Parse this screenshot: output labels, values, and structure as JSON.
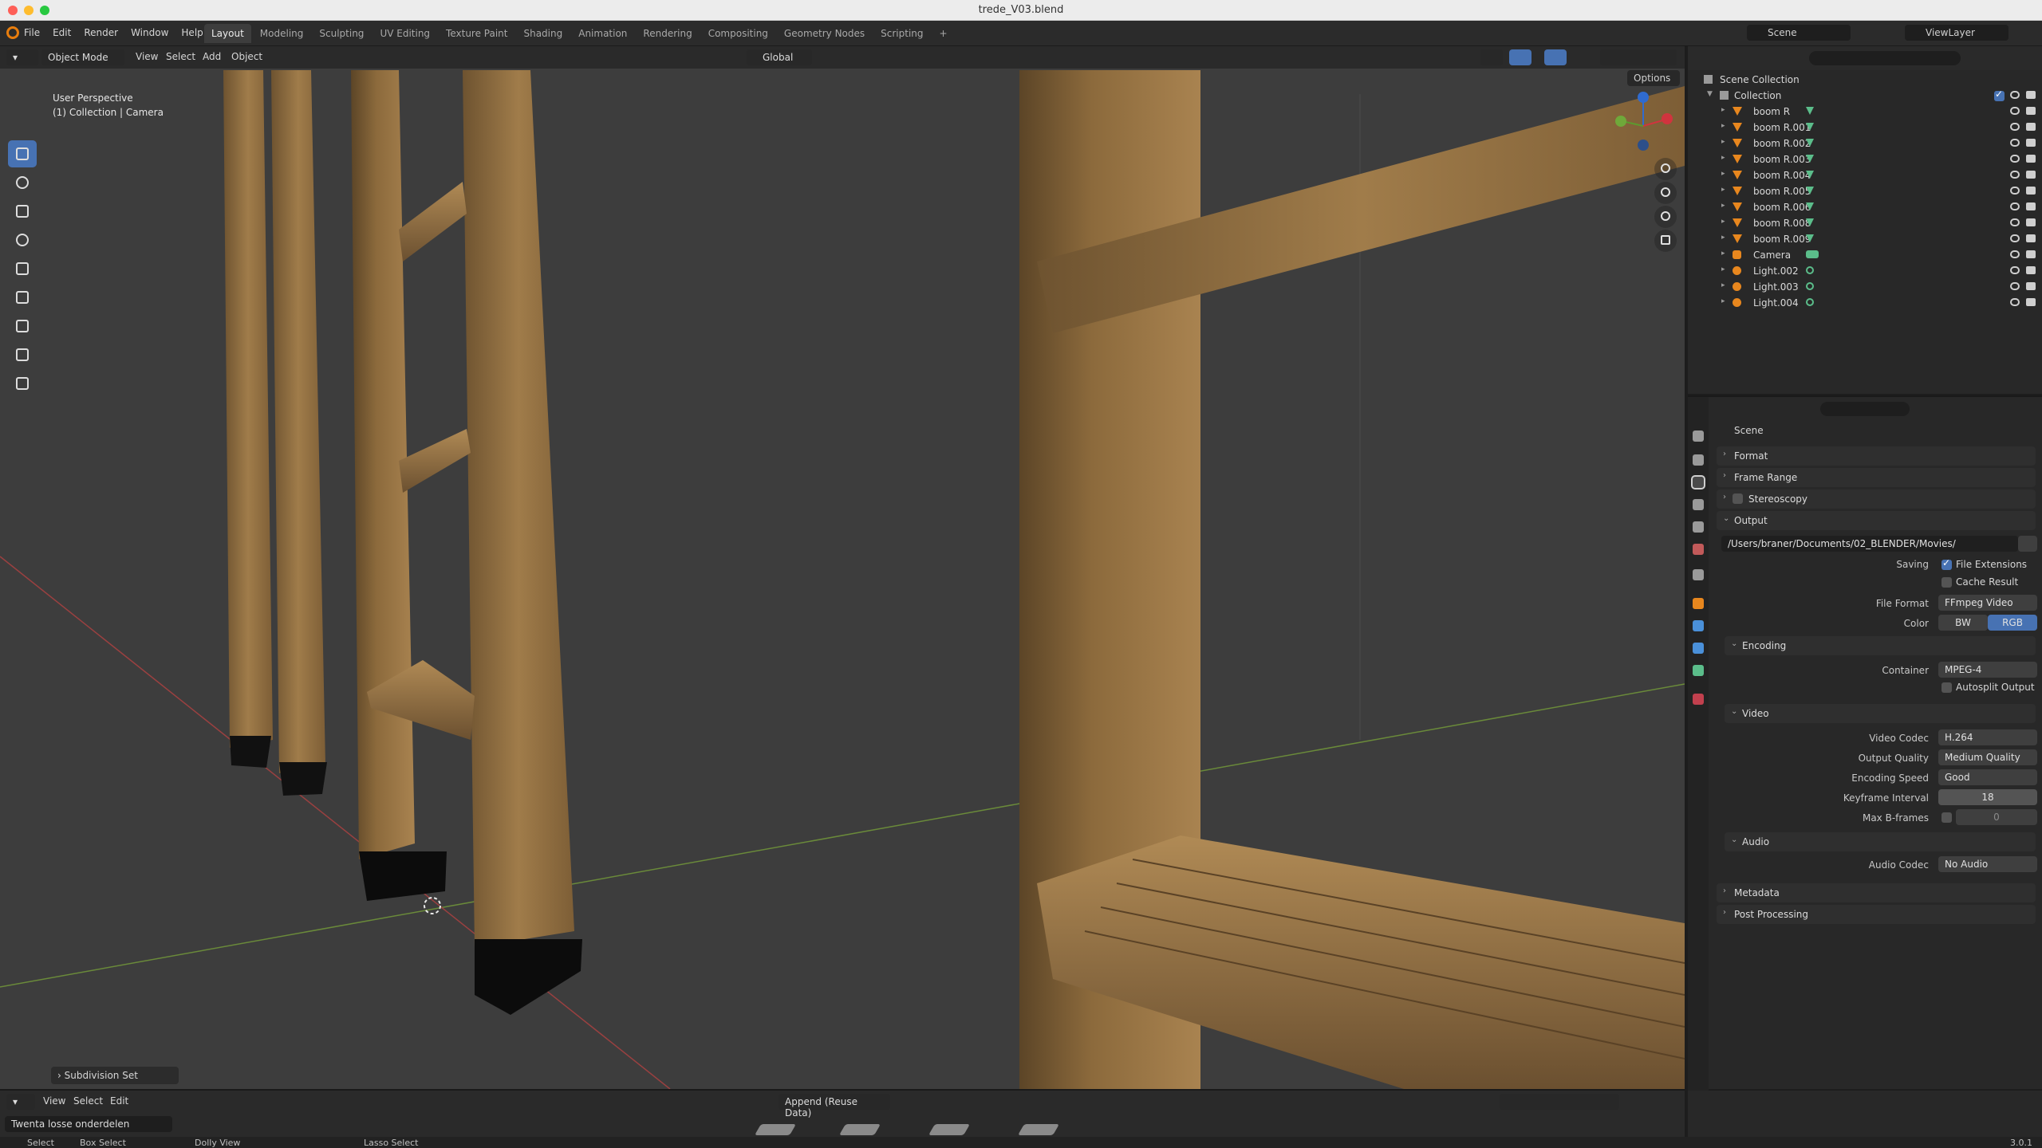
{
  "window": {
    "title": "trede_V03.blend"
  },
  "menu": [
    "File",
    "Edit",
    "Render",
    "Window",
    "Help"
  ],
  "workspaces": [
    "Layout",
    "Modeling",
    "Sculpting",
    "UV Editing",
    "Texture Paint",
    "Shading",
    "Animation",
    "Rendering",
    "Compositing",
    "Geometry Nodes",
    "Scripting",
    "+"
  ],
  "scene_name": "Scene",
  "view_layer": "ViewLayer",
  "viewport": {
    "mode": "Object Mode",
    "menus": [
      "View",
      "Select",
      "Add",
      "Object"
    ],
    "orientation": "Global",
    "info_line1": "User Perspective",
    "info_line2": "(1) Collection | Camera",
    "options_label": "Options",
    "last_op": "Subdivision Set"
  },
  "outliner": {
    "root": "Scene Collection",
    "collection": "Collection",
    "items": [
      {
        "name": "boom R",
        "type": "mesh"
      },
      {
        "name": "boom R.001",
        "type": "mesh"
      },
      {
        "name": "boom R.002",
        "type": "mesh"
      },
      {
        "name": "boom R.003",
        "type": "mesh"
      },
      {
        "name": "boom R.004",
        "type": "mesh"
      },
      {
        "name": "boom R.005",
        "type": "mesh"
      },
      {
        "name": "boom R.006",
        "type": "mesh"
      },
      {
        "name": "boom R.008",
        "type": "mesh"
      },
      {
        "name": "boom R.009",
        "type": "mesh"
      },
      {
        "name": "Camera",
        "type": "camera"
      },
      {
        "name": "Light.002",
        "type": "light"
      },
      {
        "name": "Light.003",
        "type": "light"
      },
      {
        "name": "Light.004",
        "type": "light"
      }
    ]
  },
  "properties": {
    "context": "Scene",
    "sections": {
      "format": "Format",
      "frame_range": "Frame Range",
      "stereoscopy": "Stereoscopy",
      "output": "Output",
      "encoding": "Encoding",
      "video": "Video",
      "audio": "Audio",
      "metadata": "Metadata",
      "post_processing": "Post Processing"
    },
    "output_path": "/Users/braner/Documents/02_BLENDER/Movies/",
    "saving_label": "Saving",
    "file_extensions": "File Extensions",
    "cache_result": "Cache Result",
    "file_format_label": "File Format",
    "file_format": "FFmpeg Video",
    "color_label": "Color",
    "color_bw": "BW",
    "color_rgb": "RGB",
    "container_label": "Container",
    "container": "MPEG-4",
    "autosplit": "Autosplit Output",
    "video_codec_label": "Video Codec",
    "video_codec": "H.264",
    "output_quality_label": "Output Quality",
    "output_quality": "Medium Quality",
    "encoding_speed_label": "Encoding Speed",
    "encoding_speed": "Good",
    "keyframe_interval_label": "Keyframe Interval",
    "keyframe_interval": "18",
    "max_bframes_label": "Max B-frames",
    "max_bframes": "0",
    "audio_codec_label": "Audio Codec",
    "audio_codec": "No Audio"
  },
  "timeline": {
    "menus": [
      "View",
      "Select",
      "Edit"
    ],
    "append": "Append (Reuse Data)",
    "asset_library": "Twenta losse onderdelen"
  },
  "status": {
    "select": "Select",
    "box_select": "Box Select",
    "dolly": "Dolly View",
    "lasso": "Lasso Select",
    "version": "3.0.1"
  },
  "colors": {
    "accent": "#4772b3",
    "mesh": "#e8871e",
    "modifier": "#5bbd8a",
    "wood": "#a07c4a"
  }
}
